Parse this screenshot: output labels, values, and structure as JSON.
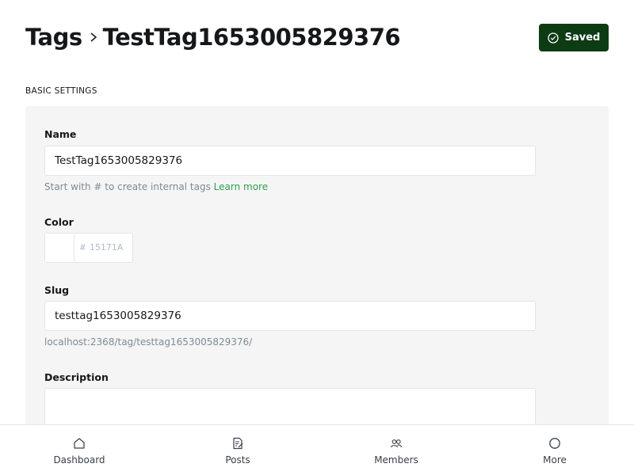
{
  "header": {
    "breadcrumb_parent": "Tags",
    "breadcrumb_current": "TestTag1653005829376",
    "save_button_label": "Saved"
  },
  "basic_settings": {
    "section_title": "BASIC SETTINGS",
    "name": {
      "label": "Name",
      "value": "TestTag1653005829376",
      "hint": "Start with # to create internal tags",
      "hint_link": "Learn more"
    },
    "color": {
      "label": "Color",
      "hash": "#",
      "placeholder": "15171A"
    },
    "slug": {
      "label": "Slug",
      "value": "testtag1653005829376",
      "url": "localhost:2368/tag/testtag1653005829376/"
    },
    "description": {
      "label": "Description",
      "value": ""
    }
  },
  "bottom_nav": {
    "items": [
      {
        "label": "Dashboard",
        "icon": "home-icon"
      },
      {
        "label": "Posts",
        "icon": "posts-icon"
      },
      {
        "label": "Members",
        "icon": "members-icon"
      },
      {
        "label": "More",
        "icon": "more-icon"
      }
    ]
  },
  "colors": {
    "save_button_bg": "#0c3b14",
    "link": "#30a152",
    "panel_bg": "#f4f5f4"
  }
}
